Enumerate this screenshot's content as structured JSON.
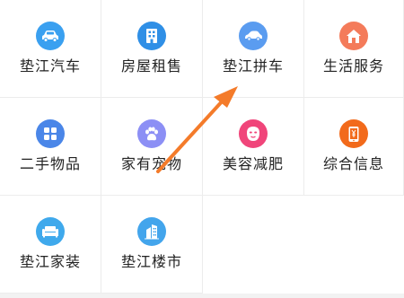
{
  "menu": {
    "items": [
      {
        "label": "垫江汽车",
        "icon": "car-icon",
        "color": "#3aa0f0"
      },
      {
        "label": "房屋租售",
        "icon": "building-icon",
        "color": "#2f8fe6"
      },
      {
        "label": "垫江拼车",
        "icon": "car-share-icon",
        "color": "#5a9cf0"
      },
      {
        "label": "生活服务",
        "icon": "home-icon",
        "color": "#f47b5a"
      },
      {
        "label": "二手物品",
        "icon": "grid-icon",
        "color": "#4a86e8"
      },
      {
        "label": "家有宠物",
        "icon": "paw-icon",
        "color": "#8c8ff5"
      },
      {
        "label": "美容减肥",
        "icon": "face-mask-icon",
        "color": "#f0457a"
      },
      {
        "label": "综合信息",
        "icon": "phone-yuan-icon",
        "color": "#f26a1b"
      },
      {
        "label": "垫江家装",
        "icon": "sofa-icon",
        "color": "#3fa9ec"
      },
      {
        "label": "垫江楼市",
        "icon": "city-building-icon",
        "color": "#43a5ec"
      }
    ]
  },
  "annotation": {
    "arrow_color": "#f47b2a"
  }
}
